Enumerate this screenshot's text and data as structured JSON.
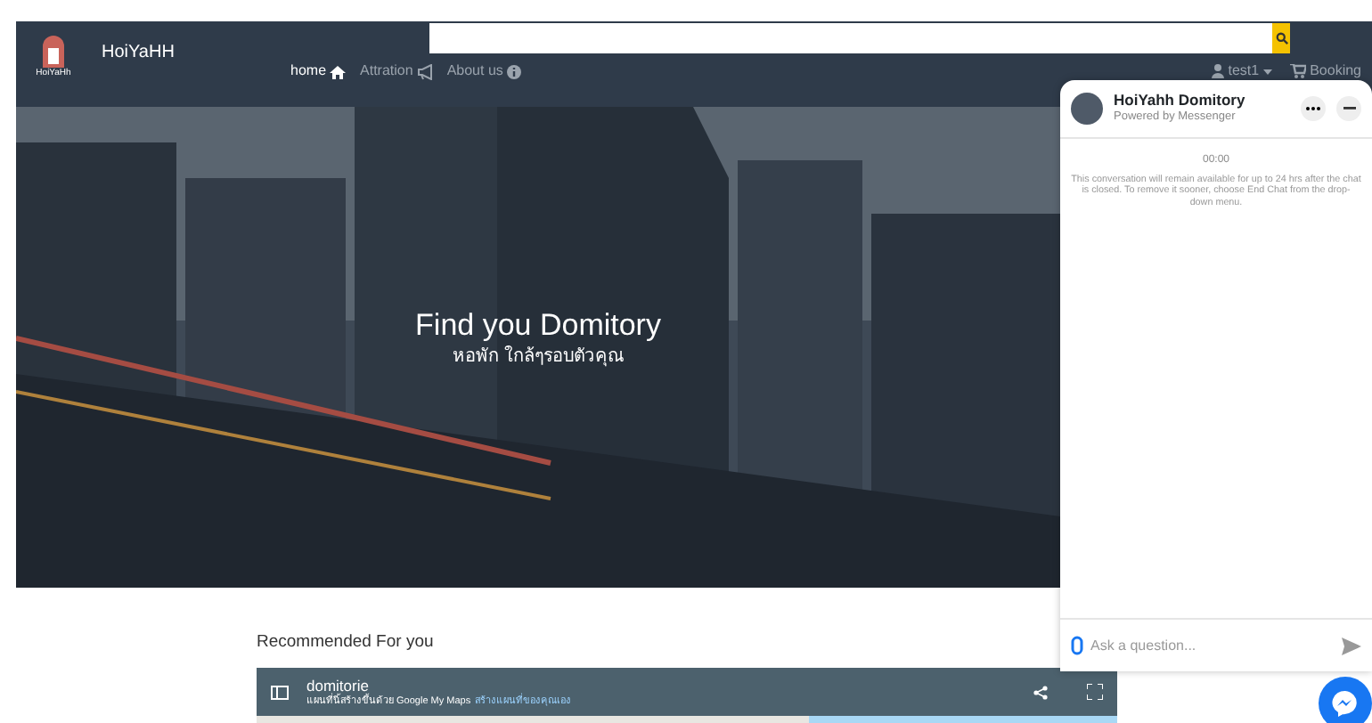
{
  "navbar": {
    "brand": "HoiYaHH",
    "logo_caption": "HoiYaHh",
    "links": [
      {
        "label": "home",
        "selected": true,
        "kind": "home"
      },
      {
        "label": "Attration",
        "selected": false,
        "kind": "megaphone"
      },
      {
        "label": "About us",
        "selected": false,
        "kind": "info"
      }
    ],
    "user": "test1",
    "booking": "Booking"
  },
  "hero": {
    "title": "Find you Domitory",
    "subtitle": "หอพัก ใกล้ๆรอบตัวคุณ"
  },
  "chat": {
    "title": "HoiYahh Domitory",
    "subtitle": "Powered by Messenger",
    "time": "00:00",
    "notice": "This conversation will remain available for up to 24 hrs after the chat is closed. To remove it sooner, choose End Chat from the drop-down menu.",
    "input": {
      "placeholder": "Ask a question..."
    }
  },
  "recommended": {
    "heading": "Recommended For you",
    "map": {
      "title": "domitorie",
      "credit": "แผนที่นี้สร้างขึ้นด้วย Google My Maps",
      "link": "สร้างแผนที่ของคุณเอง"
    }
  }
}
